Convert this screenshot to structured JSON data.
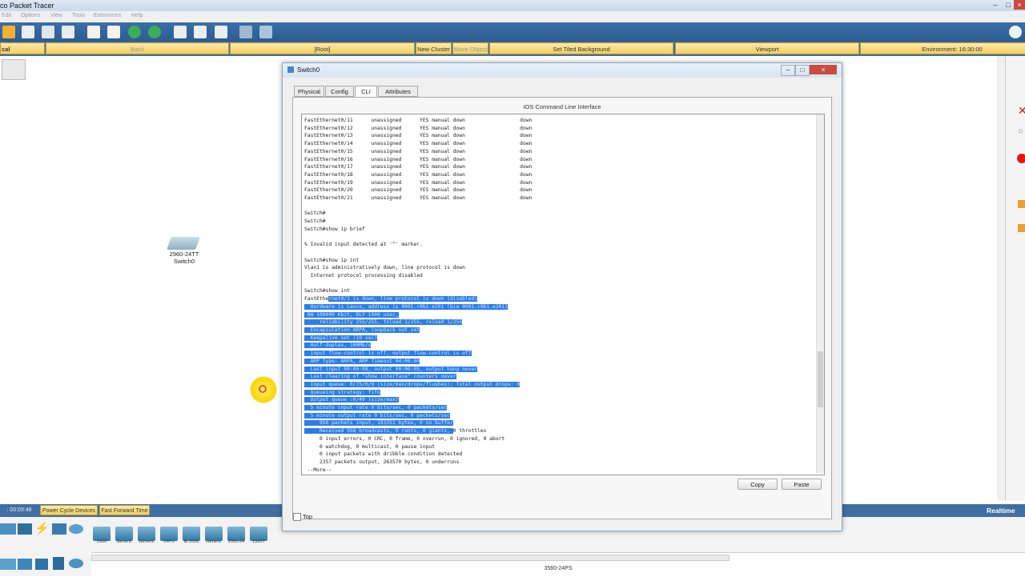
{
  "app": {
    "title": "co Packet Tracer"
  },
  "menu": [
    "Edit",
    "Options",
    "View",
    "Tools",
    "Extensions",
    "Help"
  ],
  "nav": {
    "logical": "cal",
    "back": "Back",
    "root": "[Root]",
    "new_cluster": "New Cluster",
    "move_object": "Move Object",
    "tiled_bg": "Set Tiled Background",
    "viewport": "Viewport",
    "environment": "Environment: 16:30:00"
  },
  "device": {
    "model": "2960-24TT",
    "name": "Switch0"
  },
  "bottom": {
    "time": ": 00:03:48",
    "power_cycle": "Power Cycle Devices",
    "fast_forward": "Fast Forward Time",
    "realtime": "Realtime",
    "status": "3560-24PS",
    "devices": [
      "2960",
      "Generic",
      "Generic",
      "24PS",
      "IE 2000",
      "Generic",
      "2950-24",
      "2950T"
    ]
  },
  "dialog": {
    "title": "Switch0",
    "tabs": [
      "Physical",
      "Config",
      "CLI",
      "Attributes"
    ],
    "heading": "IOS Command Line Interface",
    "copy": "Copy",
    "paste": "Paste",
    "top_label": "Top",
    "cli_lines": [
      "FastEthernet0/11      unassigned      YES manual down                  down",
      "FastEthernet0/12      unassigned      YES manual down                  down",
      "FastEthernet0/13      unassigned      YES manual down                  down",
      "FastEthernet0/14      unassigned      YES manual down                  down",
      "FastEthernet0/15      unassigned      YES manual down                  down",
      "FastEthernet0/16      unassigned      YES manual down                  down",
      "FastEthernet0/17      unassigned      YES manual down                  down",
      "FastEthernet0/18      unassigned      YES manual down                  down",
      "FastEthernet0/19      unassigned      YES manual down                  down",
      "FastEthernet0/20      unassigned      YES manual down                  down",
      "FastEthernet0/21      unassigned      YES manual down                  down",
      "",
      "Switch#",
      "Switch#",
      "Switch#show ip brief",
      "",
      "% Invalid input detected at '^' marker.",
      "",
      "Switch#show ip int",
      "Vlan1 is administratively down, line protocol is down",
      "  Internet protocol processing disabled",
      "",
      "Switch#show int",
      "FastEthernet0/1 is down, line protocol is down (disabled)",
      "  Hardware is Lance, address is 0001.c9b1.e201 (bia 0001.c9b1.e201)",
      " BW 100000 Kbit, DLY 1000 usec,",
      "     reliability 255/255, txload 1/255, rxload 1/255",
      "  Encapsulation ARPA, loopback not set",
      "  Keepalive set (10 sec)",
      "  Half-duplex, 100Mb/s",
      "  input flow-control is off, output flow-control is off",
      "  ARP type: ARPA, ARP Timeout 04:00:00",
      "  Last input 00:00:08, output 00:00:05, output hang never",
      "  Last clearing of \"show interface\" counters never",
      "  Input queue: 0/75/0/0 (size/max/drops/flushes); Total output drops: 0",
      "  Queueing strategy: fifo",
      "  Output queue :0/40 (size/max)",
      "  5 minute input rate 0 bits/sec, 0 packets/sec",
      "  5 minute output rate 0 bits/sec, 0 packets/sec",
      "     956 packets input, 193351 bytes, 0 no buffer",
      "     Received 956 broadcasts, 0 runts, 0 giants, 0 throttles",
      "     0 input errors, 0 CRC, 0 frame, 0 overrun, 0 ignored, 0 abort",
      "     0 watchdog, 0 multicast, 0 pause input",
      "     0 input packets with dribble condition detected",
      "     2357 packets output, 263570 bytes, 0 underruns",
      " --More--"
    ]
  }
}
